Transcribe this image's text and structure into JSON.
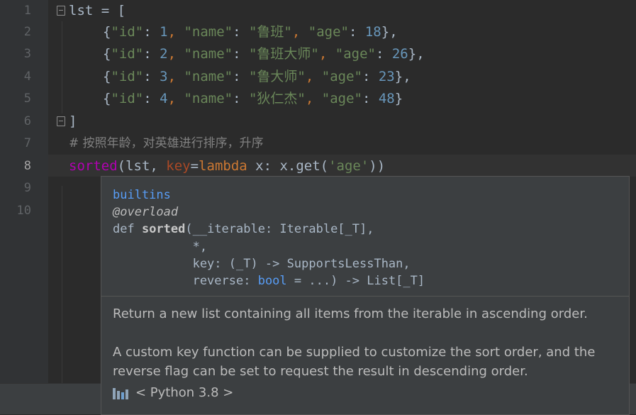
{
  "gutter": {
    "line_numbers": [
      "1",
      "2",
      "3",
      "4",
      "5",
      "6",
      "7",
      "8",
      "9",
      "10"
    ],
    "active_line": "8"
  },
  "code": {
    "line1": {
      "ident": "lst",
      "op": " = ["
    },
    "rows": [
      {
        "open": "{",
        "k_id": "\"id\"",
        "sep1": ": ",
        "id": "1",
        "c1": ", ",
        "k_name": "\"name\"",
        "sep2": ": ",
        "name": "\"鲁班\"",
        "c2": ", ",
        "k_age": "\"age\"",
        "sep3": ": ",
        "age": "18",
        "close": "},"
      },
      {
        "open": "{",
        "k_id": "\"id\"",
        "sep1": ": ",
        "id": "2",
        "c1": ", ",
        "k_name": "\"name\"",
        "sep2": ": ",
        "name": "\"鲁班大师\"",
        "c2": ", ",
        "k_age": "\"age\"",
        "sep3": ": ",
        "age": "26",
        "close": "},"
      },
      {
        "open": "{",
        "k_id": "\"id\"",
        "sep1": ": ",
        "id": "3",
        "c1": ", ",
        "k_name": "\"name\"",
        "sep2": ": ",
        "name": "\"鲁大师\"",
        "c2": ", ",
        "k_age": "\"age\"",
        "sep3": ": ",
        "age": "23",
        "close": "},"
      },
      {
        "open": "{",
        "k_id": "\"id\"",
        "sep1": ": ",
        "id": "4",
        "c1": ", ",
        "k_name": "\"name\"",
        "sep2": ": ",
        "name": "\"狄仁杰\"",
        "c2": ", ",
        "k_age": "\"age\"",
        "sep3": ": ",
        "age": "48",
        "close": "}"
      }
    ],
    "line6": "]",
    "comment": "# 按照年龄，对英雄进行排序，升序",
    "line8": {
      "fn": "sorted",
      "p1": "(lst, ",
      "kwarg": "key",
      "eq": "=",
      "lambda": "lambda",
      "rest1": " x: x.get(",
      "str": "'age'",
      "rest2": "))"
    }
  },
  "popup": {
    "module": "builtins",
    "decorator": "@overload",
    "def_kw": "def ",
    "func_name": "sorted",
    "sig_line1_rest": "(__iterable: Iterable[_T],",
    "sig_line2": "           *,",
    "sig_line3": "           key: (_T) -> SupportsLessThan,",
    "sig_line4_a": "           reverse: ",
    "sig_line4_bool": "bool",
    "sig_line4_b": " = ...) -> List[_T]",
    "doc_p1": "Return a new list containing all items from the iterable in ascending order.",
    "doc_p2": "A custom key function can be supplied to customize the sort order, and the reverse flag can be set to request the result in descending order.",
    "footer": "< Python 3.8 >",
    "footer_icon": "library-icon"
  }
}
